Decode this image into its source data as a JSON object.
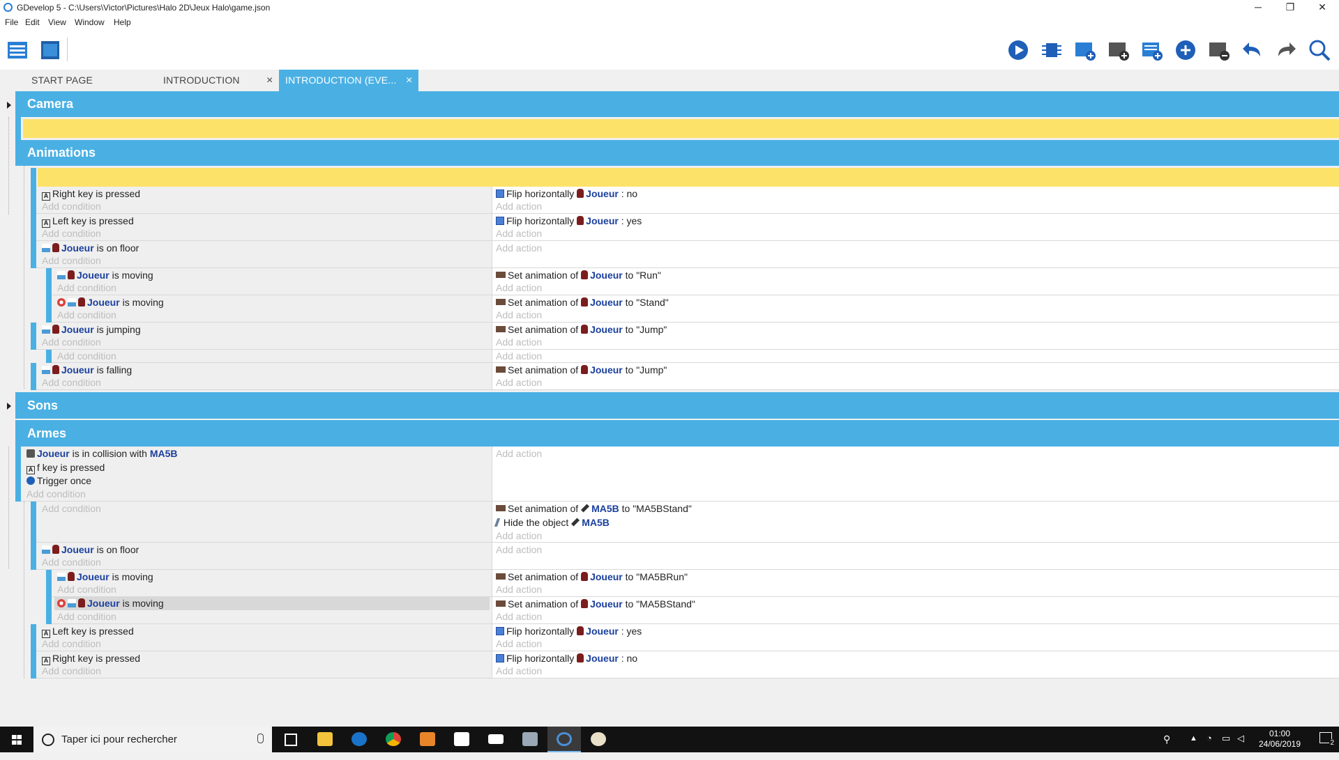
{
  "window": {
    "title": "GDevelop 5 - C:\\Users\\Victor\\Pictures\\Halo 2D\\Jeux Halo\\game.json",
    "controls": {
      "minimize": "─",
      "restore": "❐",
      "close": "✕"
    }
  },
  "menu": [
    "File",
    "Edit",
    "View",
    "Window",
    "Help"
  ],
  "toolbar_icons": [
    "project-manager-icon",
    "scene-editor-icon",
    "preview-icon",
    "debugger-icon",
    "add-event-icon",
    "add-subevent-icon",
    "add-comment-icon",
    "add-other-icon",
    "delete-icon",
    "undo-icon",
    "redo-icon",
    "search-icon"
  ],
  "tabs": [
    {
      "label": "START PAGE",
      "closable": false,
      "active": false
    },
    {
      "label": "INTRODUCTION",
      "closable": true,
      "active": false
    },
    {
      "label": "INTRODUCTION (EVE...",
      "closable": true,
      "active": true
    }
  ],
  "tab_close_glyph": "×",
  "placeholders": {
    "add_condition": "Add condition",
    "add_action": "Add action"
  },
  "groups": {
    "camera": "Camera",
    "animations": "Animations",
    "sons": "Sons",
    "armes": "Armes"
  },
  "events": {
    "e1": {
      "cond": {
        "pre": "",
        "obj": "",
        "text": "Right key is pressed"
      },
      "act": [
        {
          "pre": "Flip horizontally",
          "obj": "Joueur",
          "text": ": no"
        }
      ]
    },
    "e2": {
      "cond": {
        "pre": "",
        "obj": "",
        "text": "Left key is pressed"
      },
      "act": [
        {
          "pre": "Flip horizontally",
          "obj": "Joueur",
          "text": ": yes"
        }
      ]
    },
    "e3": {
      "cond": {
        "pre": "",
        "obj": "Joueur",
        "text": "is on floor"
      },
      "act": []
    },
    "e4": {
      "cond": {
        "pre": "",
        "obj": "Joueur",
        "text": "is moving"
      },
      "act": [
        {
          "pre": "Set animation of",
          "obj": "Joueur",
          "text": "to \"Run\""
        }
      ]
    },
    "e5": {
      "cond": {
        "pre": "",
        "obj": "Joueur",
        "text": "is moving"
      },
      "act": [
        {
          "pre": "Set animation of",
          "obj": "Joueur",
          "text": "to \"Stand\""
        }
      ]
    },
    "e6": {
      "cond": {
        "pre": "",
        "obj": "Joueur",
        "text": "is jumping"
      },
      "act": [
        {
          "pre": "Set animation of",
          "obj": "Joueur",
          "text": "to \"Jump\""
        }
      ]
    },
    "e7": {
      "cond": null,
      "act": []
    },
    "e8": {
      "cond": {
        "pre": "",
        "obj": "Joueur",
        "text": "is falling"
      },
      "act": [
        {
          "pre": "Set animation of",
          "obj": "Joueur",
          "text": "to \"Jump\""
        }
      ]
    },
    "a1": {
      "conds": [
        {
          "obj": "Joueur",
          "text": "is in collision with",
          "obj2": "MA5B"
        },
        {
          "text": "f key is pressed"
        },
        {
          "text": "Trigger once"
        }
      ]
    },
    "a2": {
      "act": [
        {
          "pre": "Set animation of",
          "obj": "MA5B",
          "text": "to \"MA5BStand\""
        },
        {
          "pre": "Hide the object",
          "obj": "MA5B",
          "text": ""
        }
      ]
    },
    "a3": {
      "cond": {
        "obj": "Joueur",
        "text": "is on floor"
      }
    },
    "a4": {
      "cond": {
        "obj": "Joueur",
        "text": "is moving"
      },
      "act": [
        {
          "pre": "Set animation of",
          "obj": "Joueur",
          "text": "to \"MA5BRun\""
        }
      ]
    },
    "a5": {
      "cond": {
        "obj": "Joueur",
        "text": "is moving"
      },
      "act": [
        {
          "pre": "Set animation of",
          "obj": "Joueur",
          "text": "to \"MA5BStand\""
        }
      ]
    },
    "a6": {
      "cond": {
        "text": "Left key is pressed"
      },
      "act": [
        {
          "pre": "Flip horizontally",
          "obj": "Joueur",
          "text": ": yes"
        }
      ]
    },
    "a7": {
      "cond": {
        "text": "Right key is pressed"
      },
      "act": [
        {
          "pre": "Flip horizontally",
          "obj": "Joueur",
          "text": ": no"
        }
      ]
    }
  },
  "taskbar": {
    "search_placeholder": "Taper ici pour rechercher",
    "apps": [
      "task-view-icon",
      "file-explorer-icon",
      "edge-icon",
      "chrome-icon",
      "media-player-icon",
      "store-icon",
      "mail-icon",
      "photos-icon",
      "gdevelop-icon",
      "paint-icon"
    ],
    "time": "01:00",
    "date": "24/06/2019",
    "notification_count": "2"
  },
  "colors": {
    "accent": "#4ab0e4",
    "comment": "#fde26a",
    "object_name": "#1a3f9c",
    "placeholder": "#bdbdbd"
  }
}
